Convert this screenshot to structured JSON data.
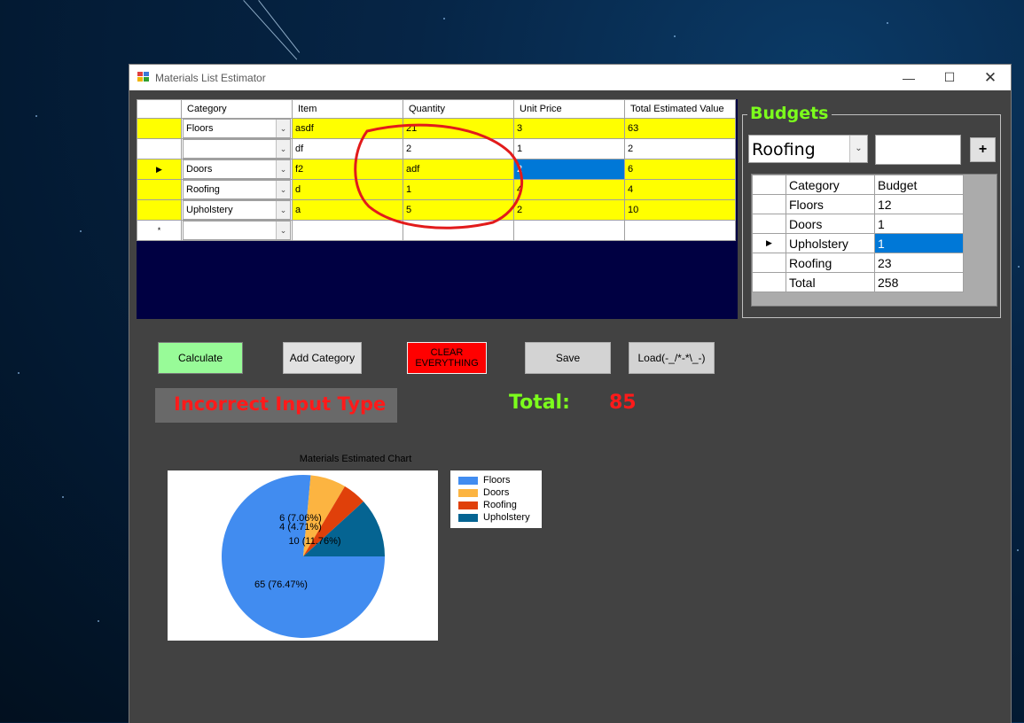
{
  "window": {
    "title": "Materials List Estimator",
    "minimize_icon": "minimize-icon",
    "maximize_icon": "maximize-icon",
    "close_icon": "close-icon"
  },
  "materials_grid": {
    "columns": [
      "",
      "Category",
      "Item",
      "Quantity",
      "Unit Price",
      "Total Estimated Value"
    ],
    "rows": [
      {
        "category": "Floors",
        "item": "asdf",
        "quantity": "21",
        "unit_price": "3",
        "total": "63",
        "highlight": true
      },
      {
        "category": "",
        "item": "df",
        "quantity": "2",
        "unit_price": "1",
        "total": "2",
        "highlight": false
      },
      {
        "category": "Doors",
        "item": "f2",
        "quantity": "adf",
        "unit_price": "2",
        "total": "6",
        "highlight": true,
        "current": true
      },
      {
        "category": "Roofing",
        "item": "d",
        "quantity": "1",
        "unit_price": "4",
        "total": "4",
        "highlight": true
      },
      {
        "category": "Upholstery",
        "item": "a",
        "quantity": "5",
        "unit_price": "2",
        "total": "10",
        "highlight": true
      }
    ],
    "new_row_marker": "*",
    "current_row_marker": "▶"
  },
  "budgets": {
    "title": "Budgets",
    "selected_category": "Roofing",
    "budget_input_value": "",
    "add_label": "+",
    "columns": [
      "Category",
      "Budget"
    ],
    "rows": [
      {
        "category": "Floors",
        "budget": "12"
      },
      {
        "category": "Doors",
        "budget": "1"
      },
      {
        "category": "Upholstery",
        "budget": "1"
      },
      {
        "category": "Roofing",
        "budget": "23"
      },
      {
        "category": "Total",
        "budget": "258"
      }
    ]
  },
  "buttons": {
    "calculate": "Calculate",
    "add_category": "Add Category",
    "clear_line1": "CLEAR",
    "clear_line2": "EVERYTHING",
    "save": "Save",
    "load": "Load(-_/*-*\\_-)"
  },
  "status": {
    "error": "Incorrect Input Type",
    "total_label": "Total:",
    "total_value": "85"
  },
  "colors": {
    "highlight_row": "#ffff00",
    "selection": "#0078d7",
    "accent_green": "#7cff1c",
    "accent_red": "#ff1a1a"
  },
  "chart_data": {
    "type": "pie",
    "title": "Materials Estimated Chart",
    "categories": [
      "Floors",
      "Doors",
      "Roofing",
      "Upholstery"
    ],
    "values": [
      65,
      6,
      4,
      10
    ],
    "labels": [
      "65 (76.47%)",
      "6 (7.06%)",
      "4 (4.71%)",
      "10 (11.76%)"
    ],
    "colors": [
      "#418cf0",
      "#fcb441",
      "#e0400a",
      "#056492"
    ],
    "legend_position": "right"
  }
}
